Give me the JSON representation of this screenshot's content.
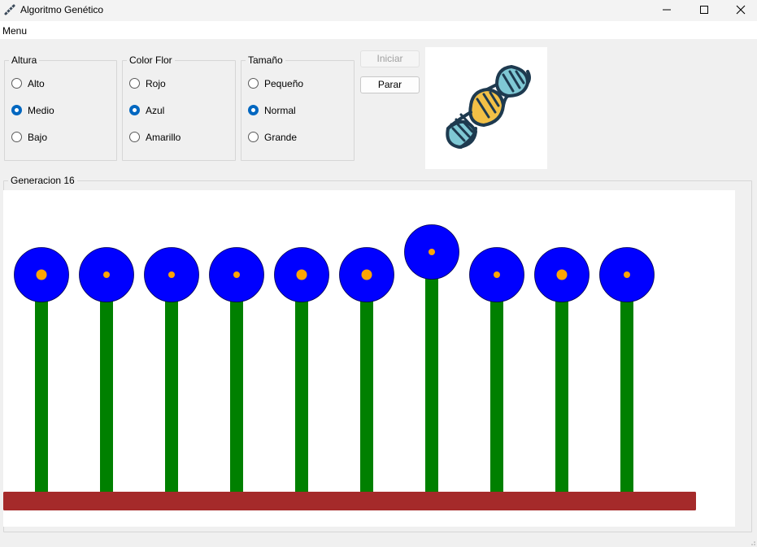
{
  "window": {
    "title": "Algoritmo Genético",
    "icon": "dna-app-icon",
    "controls": [
      "minimize-icon",
      "maximize-icon",
      "close-icon"
    ]
  },
  "menu": {
    "items": [
      "Menu"
    ]
  },
  "groups": {
    "altura": {
      "title": "Altura",
      "options": [
        "Alto",
        "Medio",
        "Bajo"
      ],
      "selected": "Medio"
    },
    "color_flor": {
      "title": "Color Flor",
      "options": [
        "Rojo",
        "Azul",
        "Amarillo"
      ],
      "selected": "Azul"
    },
    "tamano": {
      "title": "Tamaño",
      "options": [
        "Pequeño",
        "Normal",
        "Grande"
      ],
      "selected": "Normal"
    }
  },
  "buttons": {
    "iniciar": {
      "label": "Iniciar",
      "enabled": false
    },
    "parar": {
      "label": "Parar",
      "enabled": true
    }
  },
  "image": {
    "icon": "dna-icon"
  },
  "generation": {
    "label": "Generacion 16",
    "colors": {
      "stem": "#008000",
      "petal": "#0000ff",
      "center": "#ffa500",
      "ground": "#a52a2a"
    },
    "flowers": [
      {
        "height": "Medio",
        "color": "Azul",
        "center": "Normal"
      },
      {
        "height": "Medio",
        "color": "Azul",
        "center": "Pequeño"
      },
      {
        "height": "Medio",
        "color": "Azul",
        "center": "Pequeño"
      },
      {
        "height": "Medio",
        "color": "Azul",
        "center": "Pequeño"
      },
      {
        "height": "Medio",
        "color": "Azul",
        "center": "Normal"
      },
      {
        "height": "Medio",
        "color": "Azul",
        "center": "Normal"
      },
      {
        "height": "Alto",
        "color": "Azul",
        "center": "Pequeño"
      },
      {
        "height": "Medio",
        "color": "Azul",
        "center": "Pequeño"
      },
      {
        "height": "Medio",
        "color": "Azul",
        "center": "Normal"
      },
      {
        "height": "Medio",
        "color": "Azul",
        "center": "Pequeño"
      }
    ]
  }
}
